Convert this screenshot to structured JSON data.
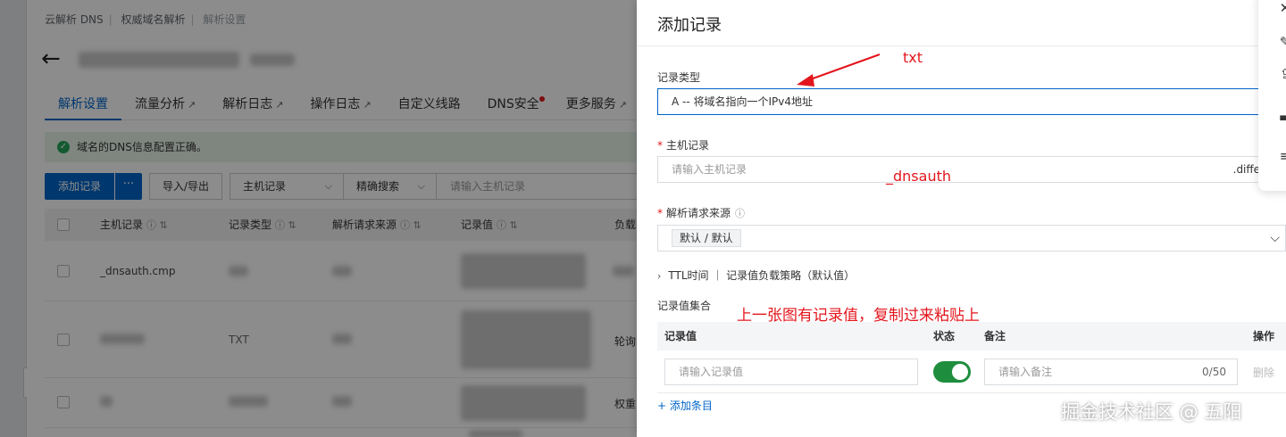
{
  "breadcrumb": [
    "云解析 DNS",
    "权威域名解析",
    "解析设置"
  ],
  "tabs": [
    {
      "label": "解析设置",
      "active": true,
      "external": false,
      "dot": false
    },
    {
      "label": "流量分析",
      "active": false,
      "external": true,
      "dot": false
    },
    {
      "label": "解析日志",
      "active": false,
      "external": true,
      "dot": false
    },
    {
      "label": "操作日志",
      "active": false,
      "external": true,
      "dot": false
    },
    {
      "label": "自定义线路",
      "active": false,
      "external": false,
      "dot": false
    },
    {
      "label": "DNS安全",
      "active": false,
      "external": false,
      "dot": true
    },
    {
      "label": "更多服务",
      "active": false,
      "external": true,
      "dot": false
    }
  ],
  "alert": {
    "text": "域名的DNS信息配置正确。"
  },
  "toolbar": {
    "add_label": "添加记录",
    "more_label": "···",
    "import_label": "导入/导出",
    "field_select": "主机记录",
    "mode_select": "精确搜索",
    "search_placeholder": "请输入主机记录"
  },
  "table": {
    "columns": [
      "主机记录",
      "记录类型",
      "解析请求来源",
      "记录值",
      "负载"
    ],
    "rows": [
      {
        "host": "_dnsauth.cmp",
        "type": "",
        "source": "",
        "value": "",
        "policy": ""
      },
      {
        "host": "",
        "type": "TXT",
        "source": "",
        "value": "",
        "policy": "轮询"
      },
      {
        "host": "",
        "type": "",
        "source": "",
        "value": "",
        "policy": "权重"
      }
    ]
  },
  "drawer": {
    "title": "添加记录",
    "record_type_label": "记录类型",
    "record_type_value": "A -- 将域名指向一个IPv4地址",
    "host_label": "主机记录",
    "host_placeholder": "请输入主机记录",
    "host_suffix": ".differsee",
    "source_label": "解析请求来源",
    "source_tag": "默认 / 默认",
    "ttl_text": "TTL时间 ｜ 记录值负载策略（默认值）",
    "value_set_label": "记录值集合",
    "value_table": {
      "columns": [
        "记录值",
        "状态",
        "备注",
        "操作"
      ],
      "value_placeholder": "请输入记录值",
      "note_placeholder": "请输入备注",
      "note_count": "0/50",
      "delete_label": "删除",
      "status_on": true
    },
    "add_entry_label": "添加条目"
  },
  "annotations": {
    "txt": "txt",
    "dnsauth": "_dnsauth",
    "copy_hint": "上一张图有记录值，复制过来粘贴上"
  },
  "floating_toolbar": {
    "icons": [
      "close-icon",
      "pencil-icon",
      "upload-icon",
      "folder-icon",
      "menu-icon"
    ]
  },
  "watermark": "掘金技术社区 @ 五阳",
  "colors": {
    "primary": "#0064c8",
    "annotation": "#e3161d",
    "toggle_on": "#1e8e3e"
  }
}
